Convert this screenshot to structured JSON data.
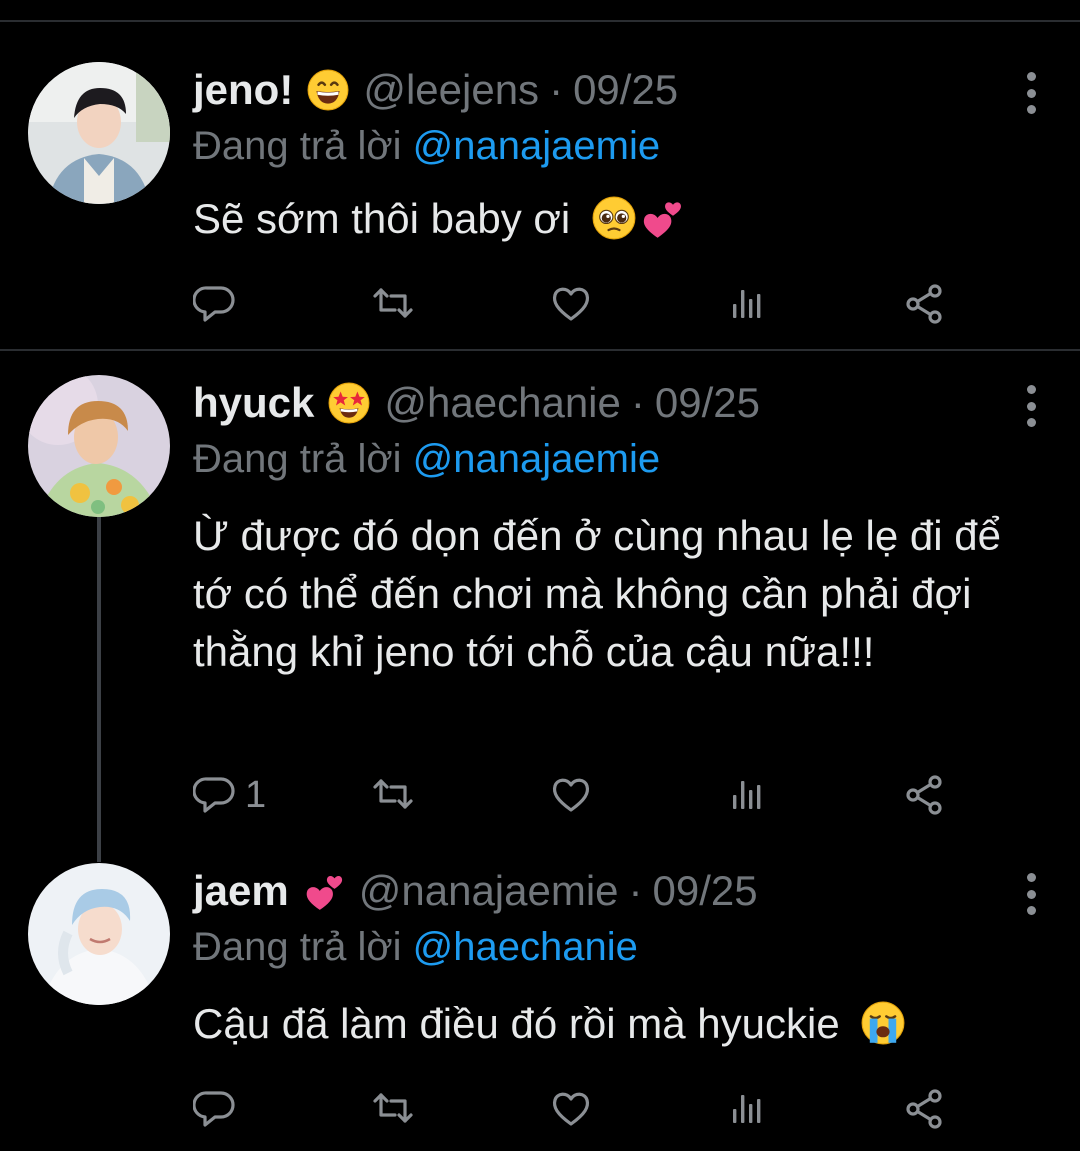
{
  "tweets": [
    {
      "name": "jeno!",
      "name_emoji": "grinning-face",
      "handle": "@leejens",
      "separator": "·",
      "date": "09/25",
      "replying_prefix": "Đang trả lời",
      "replying_to": "@nanajaemie",
      "text": "Sẽ sớm thôi baby ơi",
      "text_emojis": [
        "pleading-face",
        "two-hearts"
      ],
      "reply_count": ""
    },
    {
      "name": "hyuck",
      "name_emoji": "star-struck",
      "handle": "@haechanie",
      "separator": "·",
      "date": "09/25",
      "replying_prefix": "Đang trả lời",
      "replying_to": "@nanajaemie",
      "text": "Ừ được đó dọn đến ở cùng nhau lẹ lẹ đi để tớ có thể đến chơi mà không cần phải đợi thằng khỉ jeno tới chỗ của cậu nữa!!!",
      "text_emojis": [],
      "reply_count": "1"
    },
    {
      "name": "jaem",
      "name_emoji": "two-hearts",
      "handle": "@nanajaemie",
      "separator": "·",
      "date": "09/25",
      "replying_prefix": "Đang trả lời",
      "replying_to": "@haechanie",
      "text": "Cậu đã làm điều đó rồi mà hyuckie",
      "text_emojis": [
        "loudly-crying-face"
      ],
      "reply_count": ""
    }
  ],
  "colors": {
    "background": "#000000",
    "text": "#e7e9ea",
    "secondary": "#71767b",
    "mention": "#1d9bf0",
    "divider": "#2a2d31"
  }
}
